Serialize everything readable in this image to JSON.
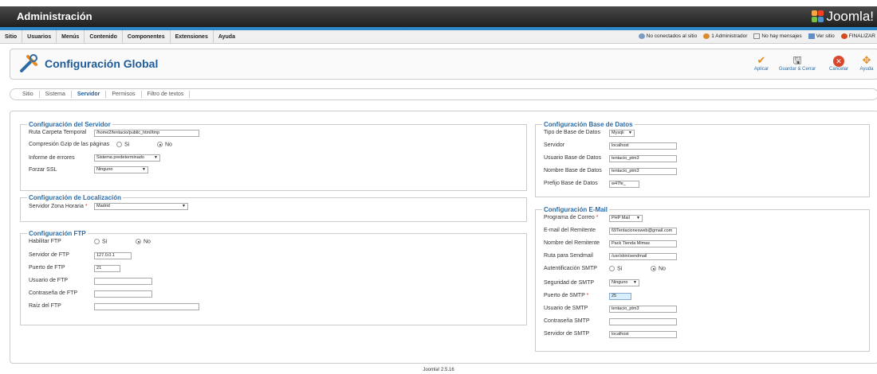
{
  "header": {
    "title": "Administración",
    "logo_text": "Joomla!"
  },
  "menu": {
    "items": [
      "Sitio",
      "Usuarios",
      "Menús",
      "Contenido",
      "Componentes",
      "Extensiones",
      "Ayuda"
    ],
    "status": {
      "visitors": "No conectados al sitio",
      "admins": "1 Administrador",
      "messages": "No hay mensajes",
      "view_site": "Ver sitio",
      "logout": "FINALIZAR"
    }
  },
  "toolbar": {
    "page_title": "Configuración Global",
    "apply": "Aplicar",
    "save_close": "Guardar & Cerrar",
    "cancel": "Cancelar",
    "help": "Ayuda"
  },
  "tabs": [
    "Sitio",
    "Sistema",
    "Servidor",
    "Permisos",
    "Filtro de textos"
  ],
  "active_tab": "Servidor",
  "server": {
    "legend": "Configuración del Servidor",
    "tmp_label": "Ruta Carpeta Temporal",
    "tmp_value": "/home2/tentacio/public_html/tmp",
    "gzip_label": "Compresión Gzip de las páginas",
    "gzip_yes": "Si",
    "gzip_no": "No",
    "errors_label": "Informe de errores",
    "errors_value": "Sistema predeterminado",
    "ssl_label": "Forzar SSL",
    "ssl_value": "Ninguno"
  },
  "locale": {
    "legend": "Configuración de Localización",
    "tz_label": "Servidor Zona Horaria",
    "tz_value": "Madrid"
  },
  "ftp": {
    "legend": "Configuración FTP",
    "enable_label": "Habilitar FTP",
    "yes": "Si",
    "no": "No",
    "host_label": "Servidor de FTP",
    "host_value": "127.0.0.1",
    "port_label": "Puerto de FTP",
    "port_value": "21",
    "user_label": "Usuario de FTP",
    "user_value": "",
    "pass_label": "Contraseña de FTP",
    "pass_value": "",
    "root_label": "Raíz del FTP",
    "root_value": ""
  },
  "database": {
    "legend": "Configuración Base de Datos",
    "type_label": "Tipo de Base de Datos",
    "type_value": "Mysqli",
    "host_label": "Servidor",
    "host_value": "localhost",
    "user_label": "Usuario Base de Datos",
    "user_value": "tentacio_ptm3",
    "name_label": "Nombre Base de Datos",
    "name_value": "tentacio_ptm3",
    "prefix_label": "Prefijo Base de Datos",
    "prefix_value": "w47fe_"
  },
  "mail": {
    "legend": "Configuración E-Mail",
    "mailer_label": "Programa de Correo",
    "mailer_value": "PHP Mail",
    "from_label": "E-mail del Remitente",
    "from_value": "69Tentacionesweb@gmail.com",
    "fromname_label": "Nombre del Remitente",
    "fromname_value": "Pack Tienda Mimas",
    "sendmail_label": "Ruta para Sendmail",
    "sendmail_value": "/usr/sbin/sendmail",
    "auth_label": "Autentificación SMTP",
    "yes": "Si",
    "no": "No",
    "secure_label": "Seguridad de SMTP",
    "secure_value": "Ninguno",
    "port_label": "Puerto de SMTP",
    "port_value": "25",
    "user_label": "Usuario de SMTP",
    "user_value": "tentacio_ptm3",
    "pass_label": "Contraseña SMTP",
    "pass_value": "",
    "host_label": "Servidor de SMTP",
    "host_value": "localhost"
  },
  "footer": {
    "version": "Joomla! 2.5.16"
  }
}
